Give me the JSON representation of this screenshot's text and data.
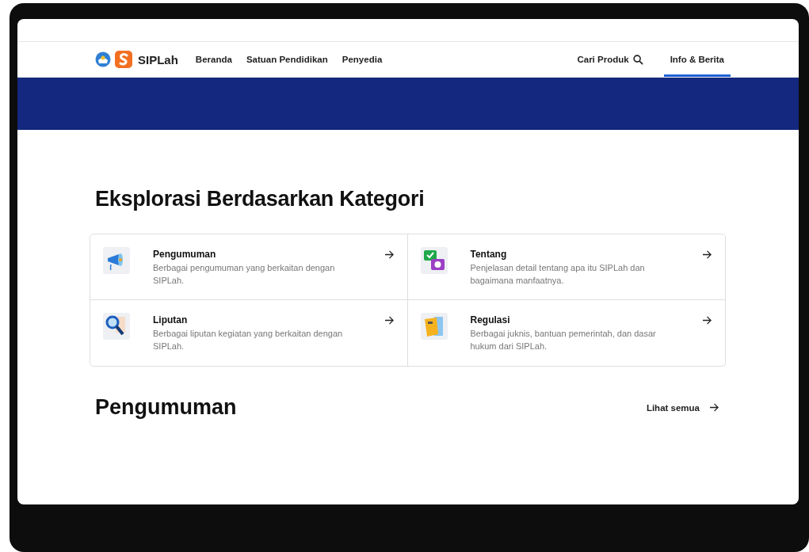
{
  "brand": {
    "name": "SIPLah"
  },
  "nav": [
    {
      "label": "Beranda"
    },
    {
      "label": "Satuan Pendidikan"
    },
    {
      "label": "Penyedia"
    }
  ],
  "nav_right": [
    {
      "label": "Cari Produk",
      "kind": "search",
      "selected": false
    },
    {
      "label": "Info & Berita",
      "kind": "plain",
      "selected": true
    }
  ],
  "heading": "Eksplorasi Berdasarkan Kategori",
  "categories": [
    {
      "kind": "megaphone",
      "title": "Pengumuman",
      "description": "Berbagai pengumuman yang berkaitan dengan SIPLah."
    },
    {
      "kind": "chat",
      "title": "Tentang",
      "description": "Penjelasan detail tentang apa itu SIPLah dan bagaimana manfaatnya."
    },
    {
      "kind": "magnifier",
      "title": "Liputan",
      "description": "Berbagai liputan kegiatan yang berkaitan dengan SIPLah."
    },
    {
      "kind": "folder",
      "title": "Regulasi",
      "description": "Berbagai juknis, bantuan pemerintah, dan dasar hukum dari SIPLah."
    }
  ],
  "section": {
    "title": "Pengumuman",
    "link": "Lihat semua"
  }
}
